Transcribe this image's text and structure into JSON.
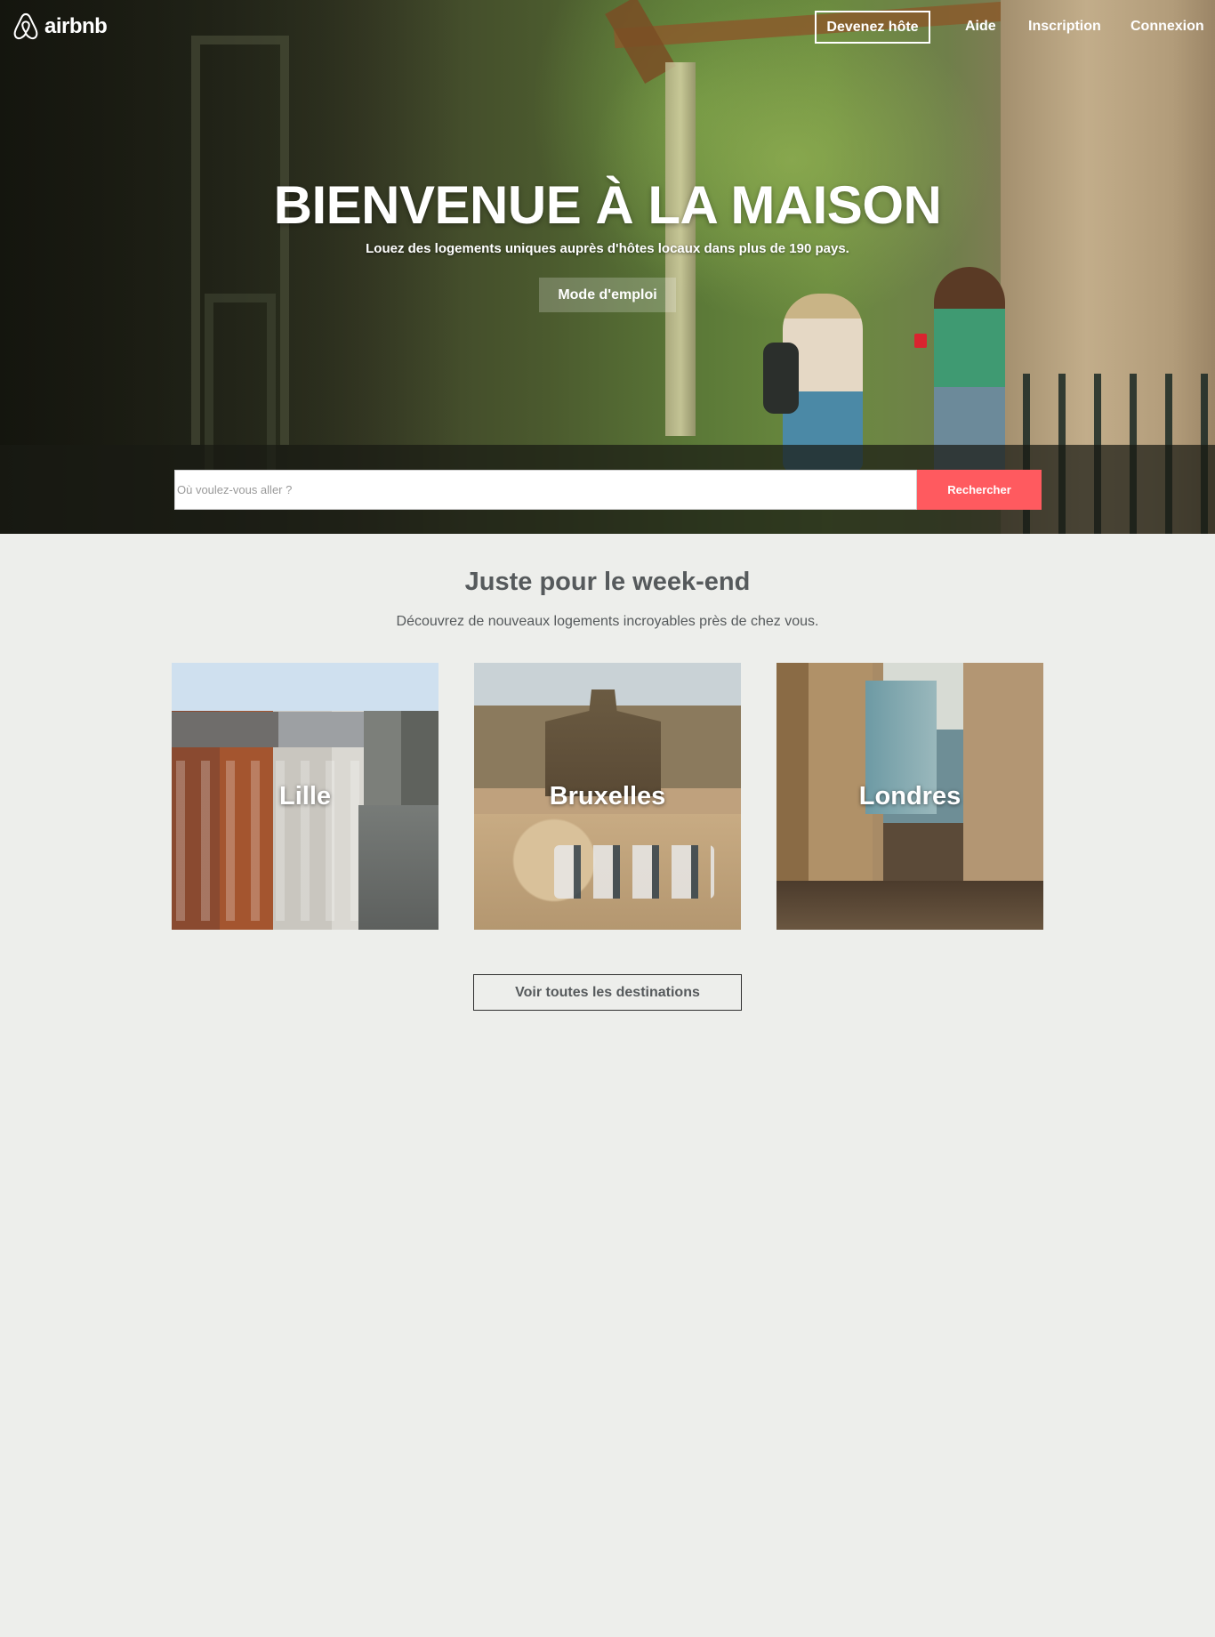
{
  "brand": {
    "name": "airbnb"
  },
  "nav": {
    "host_label": "Devenez hôte",
    "help_label": "Aide",
    "signup_label": "Inscription",
    "login_label": "Connexion"
  },
  "hero": {
    "title": "BIENVENUE À LA MAISON",
    "subtitle": "Louez des logements uniques auprès d'hôtes locaux dans plus de 190 pays.",
    "howto_label": "Mode d'emploi"
  },
  "search": {
    "placeholder": "Où voulez-vous aller ?",
    "button_label": "Rechercher"
  },
  "weekend": {
    "title": "Juste pour le week-end",
    "subtitle": "Découvrez de nouveaux logements incroyables près de chez vous.",
    "cities": [
      {
        "name": "Lille"
      },
      {
        "name": "Bruxelles"
      },
      {
        "name": "Londres"
      }
    ],
    "all_label": "Voir toutes les destinations"
  },
  "colors": {
    "accent": "#ff5a5f",
    "text": "#565a5c",
    "background": "#edeeeb"
  }
}
